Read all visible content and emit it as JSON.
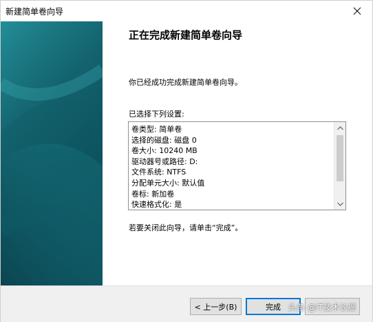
{
  "window": {
    "title": "新建简单卷向导",
    "close_icon": "close-icon"
  },
  "colors": {
    "banner_dark": "#0b4a57",
    "banner_light": "#1a7f8a",
    "accent": "#0078d7"
  },
  "content": {
    "heading": "正在完成新建简单卷向导",
    "intro": "你已经成功完成新建简单卷向导。",
    "settings_label": "已选择下列设置:",
    "settings": [
      "卷类型: 简单卷",
      "选择的磁盘: 磁盘 0",
      "卷大小: 10240 MB",
      "驱动器号或路径: D:",
      "文件系统: NTFS",
      "分配单元大小: 默认值",
      "卷标: 新加卷",
      "快速格式化: 是"
    ],
    "finish_note": "若要关闭此向导，请单击“完成”。"
  },
  "buttons": {
    "back": "< 上一步(B)",
    "finish": "完成",
    "cancel": ""
  },
  "watermark": "头条 @IT技术长廊"
}
